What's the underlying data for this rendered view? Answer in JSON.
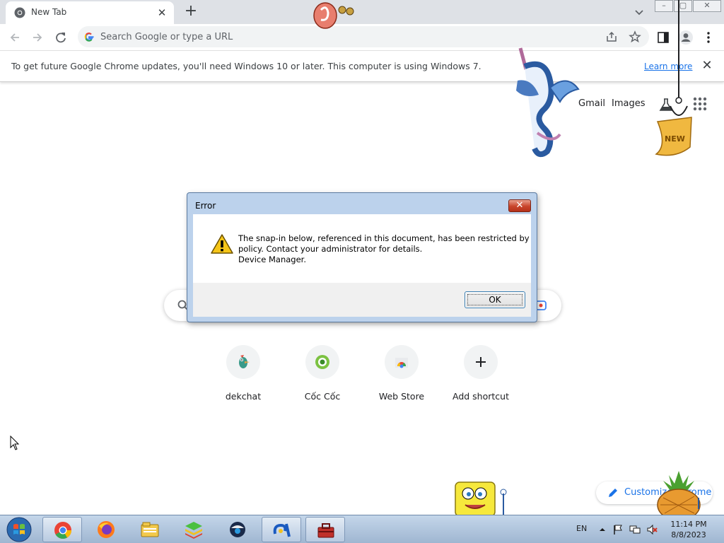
{
  "browser": {
    "tab": {
      "title": "New Tab",
      "close_glyph": "✕"
    },
    "new_tab_glyph": "+",
    "window_controls": {
      "minimize": "–",
      "maximize": "▢",
      "close": "✕"
    },
    "omnibox": {
      "placeholder": "Search Google or type a URL"
    },
    "icons": [
      "chrome-icon",
      "back-icon",
      "forward-icon",
      "reload-icon",
      "google-g-icon",
      "share-icon",
      "bookmark-star-icon",
      "side-panel-icon",
      "profile-icon",
      "more-menu-icon",
      "tab-search-icon"
    ]
  },
  "infobar": {
    "message": "To get future Google Chrome updates, you'll need Windows 10 or later. This computer is using Windows 7.",
    "link": "Learn more",
    "close_glyph": "✕"
  },
  "ntp": {
    "links": {
      "gmail": "Gmail",
      "images": "Images"
    },
    "shortcuts": [
      {
        "label": "dekchat",
        "icon": "dekchat-icon"
      },
      {
        "label": "Cốc Cốc",
        "icon": "coccoc-icon"
      },
      {
        "label": "Web Store",
        "icon": "web-store-icon"
      },
      {
        "label": "Add shortcut",
        "icon": "plus-icon",
        "glyph": "+"
      }
    ],
    "customize": {
      "label": "Customize Chrome"
    }
  },
  "dialog": {
    "title": "Error",
    "close_glyph": "✕",
    "message_line1": "The snap-in below, referenced in this document, has been restricted by",
    "message_line2": "policy. Contact your administrator for details.",
    "message_line3": "Device Manager.",
    "ok_label": "OK",
    "icon": "warning-icon"
  },
  "taskbar": {
    "apps": [
      "chrome-icon",
      "firefox-icon",
      "file-explorer-icon",
      "bluestacks-icon",
      "vpn-icon",
      "pet-app-icon",
      "toolbox-icon"
    ],
    "language": "EN",
    "time": "11:14 PM",
    "date": "8/8/2023"
  },
  "colors": {
    "link_blue": "#1a73e8",
    "dialog_frame": "#bcd2ec",
    "taskbar": "#b6cae2"
  }
}
